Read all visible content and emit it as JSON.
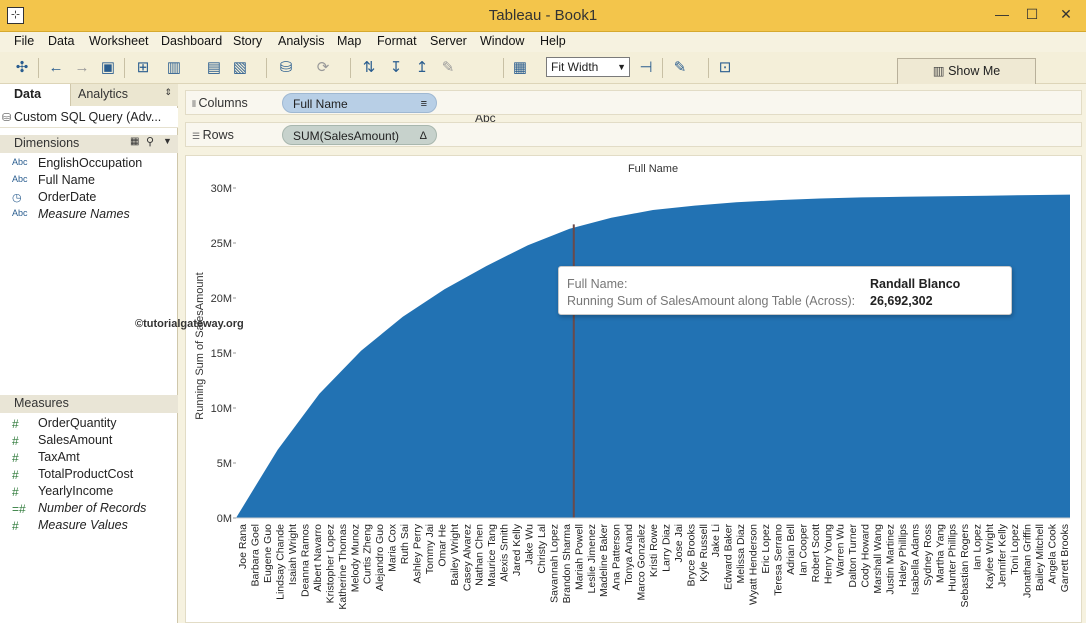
{
  "window": {
    "title": "Tableau - Book1",
    "minimize": "—",
    "maximize": "☐",
    "close": "✕"
  },
  "menu": [
    "File",
    "Data",
    "Worksheet",
    "Dashboard",
    "Story",
    "Analysis",
    "Map",
    "Format",
    "Server",
    "Window",
    "Help"
  ],
  "toolbar": {
    "fit_value": "Fit Width",
    "abc_label": "Abc",
    "show_me_label": "Show Me"
  },
  "left_pane": {
    "tab_data": "Data",
    "tab_analytics": "Analytics",
    "datasource": "Custom SQL Query (Adv...",
    "dimensions_header": "Dimensions",
    "dimensions": [
      {
        "type": "Abc",
        "name": "EnglishOccupation",
        "italic": false
      },
      {
        "type": "Abc",
        "name": "Full Name",
        "italic": false
      },
      {
        "type": "date-icon",
        "name": "OrderDate",
        "italic": false
      },
      {
        "type": "Abc",
        "name": "Measure Names",
        "italic": true
      }
    ],
    "measures_header": "Measures",
    "measures": [
      {
        "name": "OrderQuantity",
        "italic": false
      },
      {
        "name": "SalesAmount",
        "italic": false
      },
      {
        "name": "TaxAmt",
        "italic": false
      },
      {
        "name": "TotalProductCost",
        "italic": false
      },
      {
        "name": "YearlyIncome",
        "italic": false
      },
      {
        "name": "Number of Records",
        "italic": true
      },
      {
        "name": "Measure Values",
        "italic": true
      }
    ]
  },
  "shelves": {
    "columns_label": "Columns",
    "columns_pill": "Full Name",
    "rows_label": "Rows",
    "rows_pill": "SUM(SalesAmount)",
    "rows_pill_icon": "Δ"
  },
  "watermark": "©tutorialgateway.org",
  "tooltip": {
    "label1": "Full Name:",
    "value1": "Randall Blanco",
    "label2": "Running Sum of SalesAmount along Table (Across):",
    "value2": "26,692,302"
  },
  "colors": {
    "area_fill": "#2272b3",
    "title_bar": "#f3c54b",
    "highlight_line": "#6a4a4a"
  },
  "chart_data": {
    "type": "area",
    "title": "Full Name",
    "ylabel": "Running Sum of SalesAmount",
    "xlabel": "",
    "ylim": [
      0,
      30000000
    ],
    "yticks": [
      0,
      5000000,
      10000000,
      15000000,
      20000000,
      25000000,
      30000000
    ],
    "ytick_labels": [
      "0M",
      "5M",
      "10M",
      "15M",
      "20M",
      "25M",
      "30M"
    ],
    "x_labels": [
      "Joe Rana",
      "Barbara Goel",
      "Eugene Guo",
      "Lindsay Chande",
      "Isaiah Wright",
      "Deanna Ramos",
      "Albert Navarro",
      "Kristopher Lopez",
      "Katherine Thomas",
      "Melody Munoz",
      "Curtis Zheng",
      "Alejandro Guo",
      "Maria Cox",
      "Ruth Sai",
      "Ashley Perry",
      "Tommy Jai",
      "Omar He",
      "Bailey Wright",
      "Casey Alvarez",
      "Nathan Chen",
      "Maurice Tang",
      "Alexis Smith",
      "Jared Kelly",
      "Jake Wu",
      "Christy Lal",
      "Savannah Lopez",
      "Brandon Sharma",
      "Mariah Powell",
      "Leslie Jimenez",
      "Madeline Baker",
      "Ana Patterson",
      "Tonya Anand",
      "Marco Gonzalez",
      "Kristi Rowe",
      "Larry Diaz",
      "Jose Jai",
      "Bryce Brooks",
      "Kyle Russell",
      "Jake Li",
      "Edward Baker",
      "Melissa Diaz",
      "Wyatt Henderson",
      "Eric Lopez",
      "Teresa Serrano",
      "Adrian Bell",
      "Ian Cooper",
      "Robert Scott",
      "Henry Young",
      "Warren Wu",
      "Dalton Turner",
      "Cody Howard",
      "Marshall Wang",
      "Justin Martinez",
      "Haley Phillips",
      "Isabella Adams",
      "Sydney Ross",
      "Martha Yang",
      "Hunter Phillips",
      "Sebastian Rogers",
      "Ian Lopez",
      "Kaylee Wright",
      "Jennifer Kelly",
      "Toni Lopez",
      "Jonathan Griffin",
      "Bailey Mitchell",
      "Angela Cook",
      "Garrett Brooks"
    ],
    "running_sum_x": [
      0,
      0.05,
      0.1,
      0.15,
      0.2,
      0.25,
      0.3,
      0.35,
      0.4,
      0.45,
      0.5,
      0.55,
      0.6,
      0.65,
      0.7,
      0.75,
      0.8,
      0.85,
      0.9,
      0.95,
      1.0
    ],
    "running_sum_y": [
      0,
      6200000,
      11300000,
      15200000,
      18300000,
      20800000,
      22900000,
      24800000,
      26300000,
      27300000,
      28000000,
      28400000,
      28700000,
      28900000,
      29050000,
      29150000,
      29200000,
      29250000,
      29300000,
      29350000,
      29400000
    ],
    "highlighted_label": "Randall Blanco",
    "highlighted_value": 26692302,
    "highlighted_fraction": 0.405
  }
}
